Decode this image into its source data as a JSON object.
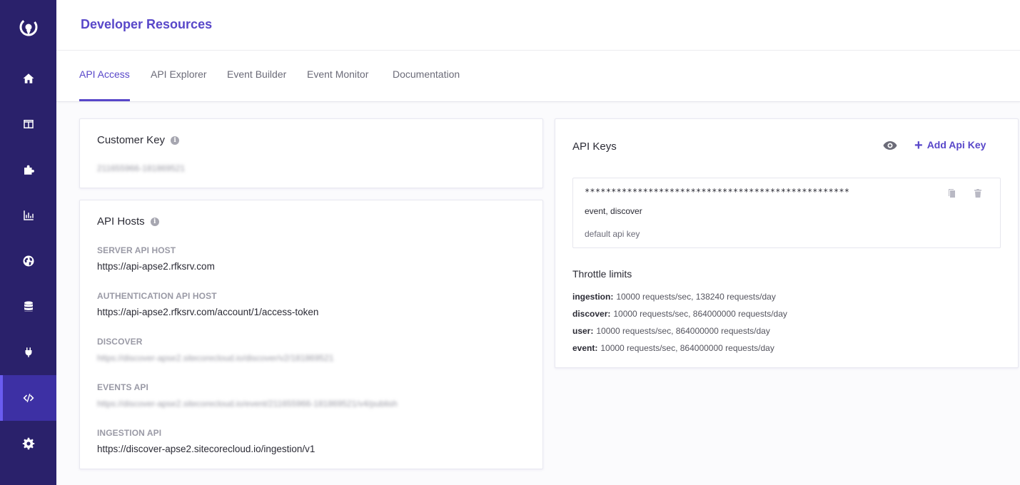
{
  "sidebar": {
    "logo_icon": "sitecore-logo-icon",
    "items": [
      {
        "name": "home",
        "icon": "home-icon"
      },
      {
        "name": "layout",
        "icon": "layout-icon"
      },
      {
        "name": "widgets",
        "icon": "puzzle-icon"
      },
      {
        "name": "analytics",
        "icon": "bar-chart-icon"
      },
      {
        "name": "global",
        "icon": "globe-icon"
      },
      {
        "name": "data",
        "icon": "database-icon"
      },
      {
        "name": "integrations",
        "icon": "plug-icon"
      },
      {
        "name": "developer",
        "icon": "code-icon",
        "active": true
      },
      {
        "name": "settings",
        "icon": "gear-icon"
      }
    ],
    "colors": {
      "bg": "#2a216b",
      "active": "#3d30a4"
    }
  },
  "header": {
    "title": "Developer Resources"
  },
  "tabs": [
    {
      "label": "API Access",
      "active": true
    },
    {
      "label": "API Explorer"
    },
    {
      "label": "Event Builder"
    },
    {
      "label": "Event Monitor"
    },
    {
      "label": "Documentation"
    }
  ],
  "customer_key": {
    "title": "Customer Key",
    "value": "211655966-181869521"
  },
  "api_hosts": {
    "title": "API Hosts",
    "fields": [
      {
        "label": "SERVER API HOST",
        "value": "https://api-apse2.rfksrv.com"
      },
      {
        "label": "AUTHENTICATION API HOST",
        "value": "https://api-apse2.rfksrv.com/account/1/access-token"
      },
      {
        "label": "DISCOVER",
        "value": "https://discover-apse2.sitecorecloud.io/discover/v2/181869521"
      },
      {
        "label": "EVENTS API",
        "value": "https://discover-apse2.sitecorecloud.io/event/211655966-181869521/v4/publish"
      },
      {
        "label": "INGESTION API",
        "value": "https://discover-apse2.sitecorecloud.io/ingestion/v1"
      }
    ]
  },
  "api_keys": {
    "title": "API Keys",
    "add_label": "Add Api Key",
    "keys": [
      {
        "masked": "**************************************************",
        "scopes": "event, discover",
        "description": "default api key"
      }
    ],
    "throttle": {
      "title": "Throttle limits",
      "rows": [
        {
          "name": "ingestion:",
          "value": "10000 requests/sec, 138240 requests/day"
        },
        {
          "name": "discover:",
          "value": "10000 requests/sec, 864000000 requests/day"
        },
        {
          "name": "user:",
          "value": "10000 requests/sec, 864000000 requests/day"
        },
        {
          "name": "event:",
          "value": "10000 requests/sec, 864000000 requests/day"
        }
      ]
    }
  },
  "colors": {
    "accent": "#5847c9",
    "page_bg": "#fbfbfd"
  }
}
